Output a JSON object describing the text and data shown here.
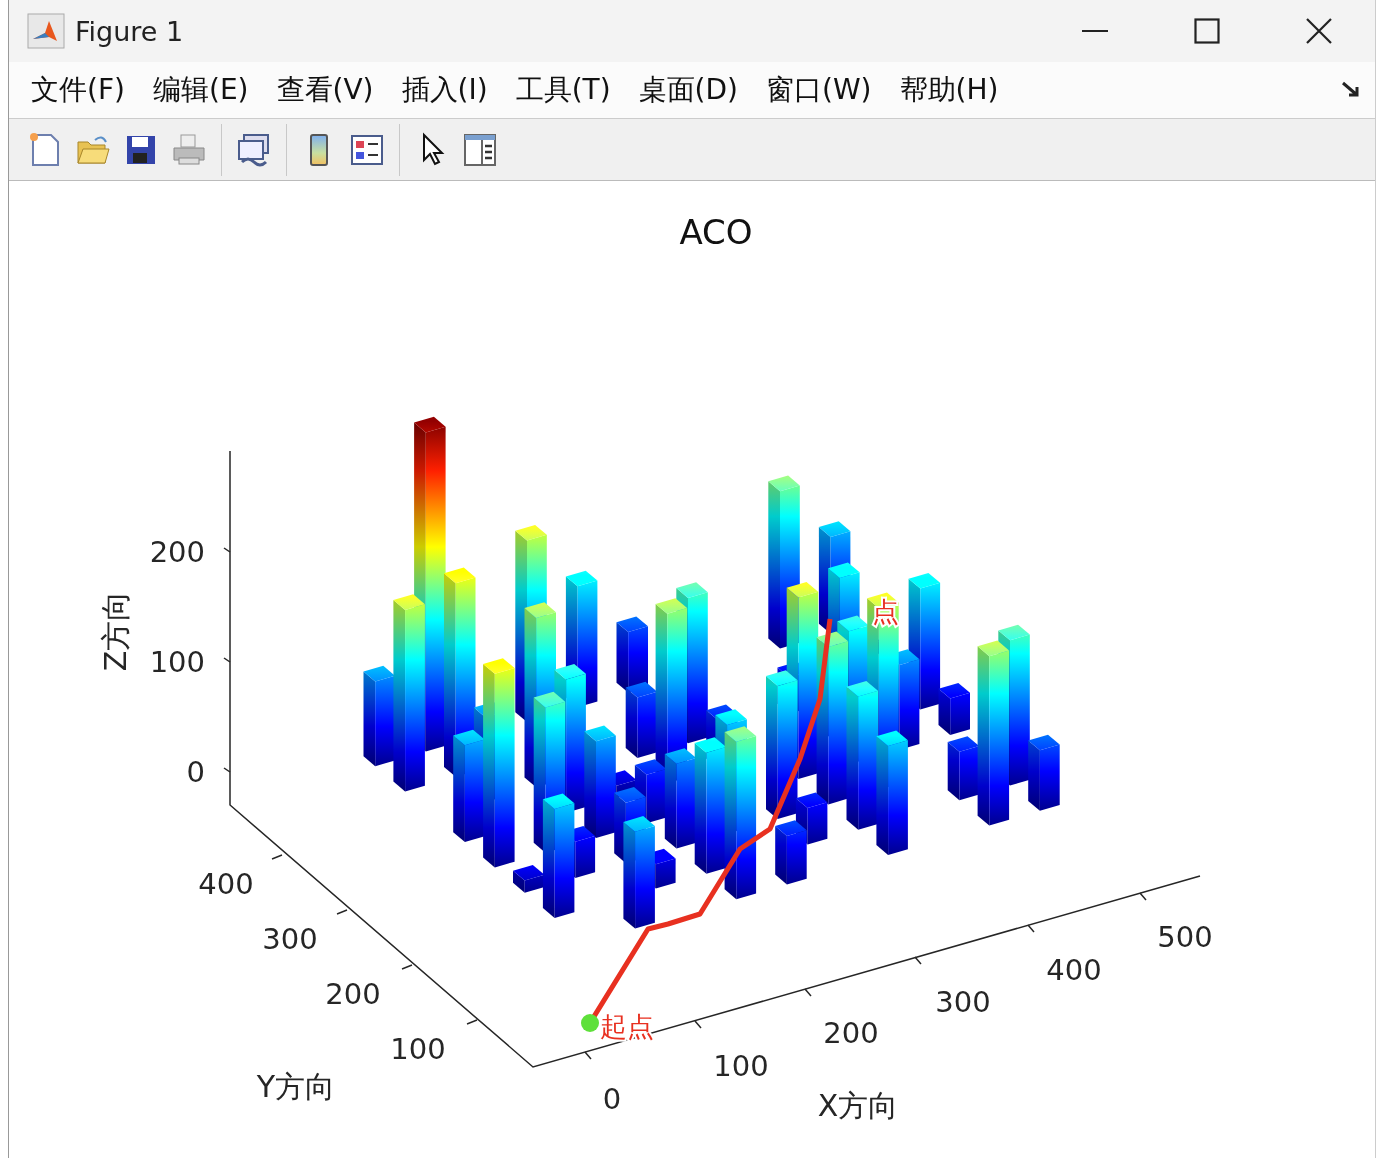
{
  "window": {
    "title": "Figure 1"
  },
  "menu": [
    "文件(F)",
    "编辑(E)",
    "查看(V)",
    "插入(I)",
    "工具(T)",
    "桌面(D)",
    "窗口(W)",
    "帮助(H)"
  ],
  "plot": {
    "title": "ACO",
    "z_axis": {
      "label": "Z方向",
      "ticks": [
        "200",
        "100",
        "0"
      ]
    },
    "y_axis": {
      "label": "Y方向",
      "ticks": [
        "400",
        "300",
        "200",
        "100"
      ]
    },
    "x_axis": {
      "label": "X方向",
      "ticks": [
        "0",
        "100",
        "200",
        "300",
        "400",
        "500"
      ]
    },
    "annotations": [
      {
        "kind": "start",
        "text": "起点"
      },
      {
        "kind": "end",
        "text": "点"
      }
    ]
  }
}
